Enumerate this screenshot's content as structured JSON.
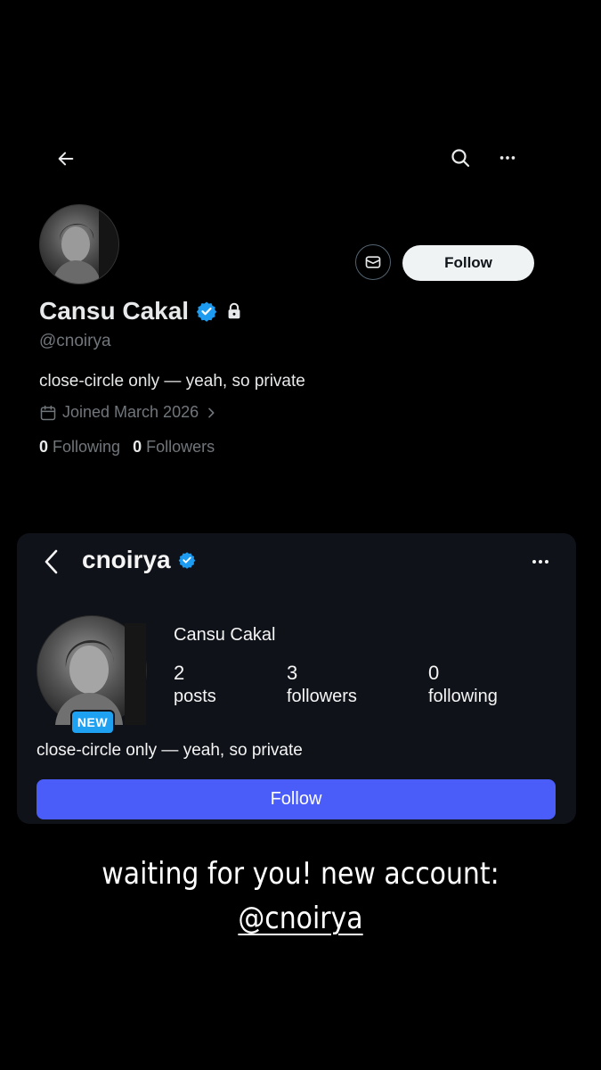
{
  "x_profile": {
    "display_name": "Cansu Cakal",
    "handle": "@cnoirya",
    "bio": "close-circle only — yeah, so private",
    "joined": "Joined March 2026",
    "following_count": "0",
    "following_label": "Following",
    "followers_count": "0",
    "followers_label": "Followers",
    "follow_label": "Follow",
    "icons": {
      "back": "arrow-left-icon",
      "search": "search-icon",
      "more": "more-horizontal-icon",
      "message": "envelope-icon",
      "verified": "verified-badge-icon",
      "lock": "lock-icon",
      "calendar": "calendar-icon",
      "chevron": "chevron-right-icon"
    }
  },
  "instagram_card": {
    "username": "cnoirya",
    "full_name": "Cansu Cakal",
    "badge": "NEW",
    "posts_count": "2",
    "posts_label": "posts",
    "followers_count": "3",
    "followers_label": "followers",
    "following_count": "0",
    "following_label": "following",
    "bio": "close-circle only — yeah, so private",
    "follow_label": "Follow"
  },
  "caption": {
    "line1": "waiting for you! new account:",
    "mention": "@cnoirya"
  },
  "colors": {
    "background": "#000000",
    "verified_blue": "#1d9bf0",
    "ig_follow_button": "#4a5df9",
    "x_follow_button": "#eff3f4",
    "muted_text": "#71767b"
  }
}
